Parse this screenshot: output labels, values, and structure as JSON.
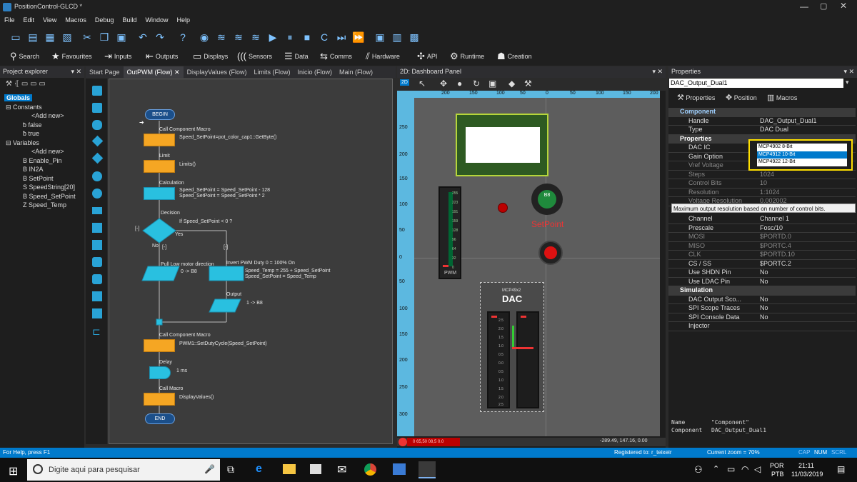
{
  "window": {
    "title": "PositionControl-GLCD *"
  },
  "menu": [
    "File",
    "Edit",
    "View",
    "Macros",
    "Debug",
    "Build",
    "Window",
    "Help"
  ],
  "toolbar2": [
    {
      "label": "Search",
      "icon": "search-icon"
    },
    {
      "label": "Favourites",
      "icon": "star-icon"
    },
    {
      "label": "Inputs",
      "icon": "input-icon"
    },
    {
      "label": "Outputs",
      "icon": "output-icon"
    },
    {
      "label": "Displays",
      "icon": "display-icon"
    },
    {
      "label": "Sensors",
      "icon": "sensor-icon"
    },
    {
      "label": "Data",
      "icon": "data-icon"
    },
    {
      "label": "Comms",
      "icon": "comms-icon"
    },
    {
      "label": "Hardware",
      "icon": "hardware-icon"
    },
    {
      "label": "API",
      "icon": "api-icon"
    },
    {
      "label": "Runtime",
      "icon": "runtime-icon"
    },
    {
      "label": "Creation",
      "icon": "creation-icon"
    }
  ],
  "project_explorer": {
    "title": "Project explorer",
    "root": "Globals",
    "items": [
      "Constants",
      "<Add new>",
      "false",
      "true",
      "Variables",
      "<Add new>",
      "Enable_Pin",
      "IN2A",
      "SetPoint",
      "SpeedString[20]",
      "Speed_SetPoint",
      "Speed_Temp"
    ]
  },
  "tabs": [
    "Start Page",
    "OutPWM (Flow)",
    "DisplayValues (Flow)",
    "Limits (Flow)",
    "Inicio (Flow)",
    "Main (Flow)"
  ],
  "flow": {
    "begin": "BEGIN",
    "end": "END",
    "call1_title": "Call Component Macro",
    "call1_body": "Speed_SetPoint=pot_color_cap1::GetByte()",
    "limit_title": "Limit",
    "limit_body": "Limits()",
    "calc_title": "Calculation",
    "calc_body1": "Speed_SetPoint = Speed_SetPoint - 128",
    "calc_body2": "Speed_SetPoint = Speed_SetPoint * 2",
    "decision_title": "Decision",
    "decision_body": "If Speed_SetPoint < 0 ?",
    "yes": "Yes",
    "no": "No",
    "collapse": "[-]",
    "pull_title": "Pull Low motor direction",
    "pull_body": "0 -> B8",
    "invert_title": "Invert PWM Duty 0 = 100% On",
    "invert_body1": "Speed_Temp = 255 + Speed_SetPoint",
    "invert_body2": "Speed_SetPoint = Speed_Temp",
    "output_title": "Output",
    "output_body": "1 -> B8",
    "call2_title": "Call Component Macro",
    "call2_body": "PWM1::SetDutyCycle(Speed_SetPoint)",
    "delay_title": "Delay",
    "delay_body": "1 ms",
    "macro_title": "Call Macro",
    "macro_body": "DisplayValues()"
  },
  "dashboard": {
    "title": "2D: Dashboard Panel",
    "ruler_top": [
      "200",
      "150",
      "100",
      "50",
      "0",
      "50",
      "100",
      "150",
      "200"
    ],
    "ruler_left": [
      "250",
      "200",
      "150",
      "100",
      "50",
      "0",
      "50",
      "100",
      "150",
      "200",
      "250",
      "300"
    ],
    "setpoint_label": "SetPoint",
    "b8_label": "B8",
    "pwm_label": "PWM",
    "dac_model": "MCP49x2",
    "dac_label": "DAC",
    "pwm_ticks": [
      "255",
      "223",
      "191",
      "159",
      "128",
      "96",
      "64",
      "32",
      "0"
    ],
    "dac_ticks": [
      "2.5",
      "2.0",
      "1.5",
      "1.0",
      "0.5",
      "0.0",
      "0.5",
      "1.0",
      "1.5",
      "2.0",
      "2.5"
    ],
    "status_left": "0 65,50 08,5 0.0",
    "coords": "-289.49, 147.16, 0.00"
  },
  "properties": {
    "title": "Properties",
    "handle_field": "DAC_Output_Dual1",
    "tab_properties": "Properties",
    "tab_position": "Position",
    "tab_macros": "Macros",
    "sections": {
      "component": "Component",
      "properties": "Properties",
      "simulation": "Simulation"
    },
    "rows": [
      {
        "k": "Handle",
        "v": "DAC_Output_Dual1"
      },
      {
        "k": "Type",
        "v": "DAC Dual"
      },
      {
        "k": "DAC IC",
        "v": ""
      },
      {
        "k": "Gain Option",
        "v": ""
      },
      {
        "k": "Vref Voltage",
        "v": ""
      },
      {
        "k": "Steps",
        "v": "1024"
      },
      {
        "k": "Control Bits",
        "v": "10"
      },
      {
        "k": "Resolution",
        "v": "1:1024"
      },
      {
        "k": "Voltage Resolution",
        "v": "0.002002"
      },
      {
        "k": "Channel",
        "v": "Channel 1"
      },
      {
        "k": "Prescale",
        "v": "Fosc/10"
      },
      {
        "k": "MOSI",
        "v": "$PORTD.0"
      },
      {
        "k": "MISO",
        "v": "$PORTC.4"
      },
      {
        "k": "CLK",
        "v": "$PORTD.10"
      },
      {
        "k": "CS / SS",
        "v": "$PORTC.2"
      },
      {
        "k": "Use SHDN Pin",
        "v": "No"
      },
      {
        "k": "Use LDAC Pin",
        "v": "No"
      },
      {
        "k": "DAC Output Sco...",
        "v": "No"
      },
      {
        "k": "SPI Scope Traces",
        "v": "No"
      },
      {
        "k": "SPI Console Data",
        "v": "No"
      },
      {
        "k": "Injector",
        "v": ""
      }
    ],
    "dropdown_options": [
      "MCP4902 8-Bit",
      "MCP4912 10-Bit",
      "MCP4922 12-Bit"
    ],
    "selected_option": "MCP4912 10-Bit",
    "tooltip": "Maximum output resolution based on number of control bits.",
    "info_name_key": "Name",
    "info_name_val": "\"Component\"",
    "info_comp_key": "Component",
    "info_comp_val": "DAC_Output_Dual1"
  },
  "statusbar": {
    "help": "For Help, press F1",
    "registered": "Registered to: r_teixeir",
    "zoom": "Current zoom = 70%",
    "cap": "CAP",
    "num": "NUM",
    "scrl": "SCRL"
  },
  "taskbar": {
    "search_placeholder": "Digite aqui para pesquisar",
    "lang1": "POR",
    "lang2": "PTB",
    "time": "21:11",
    "date": "11/03/2019"
  },
  "colors": {
    "accent": "#007acc",
    "flow_orange": "#f5a623",
    "flow_cyan": "#29c0e0",
    "highlight": "#ffe000"
  }
}
